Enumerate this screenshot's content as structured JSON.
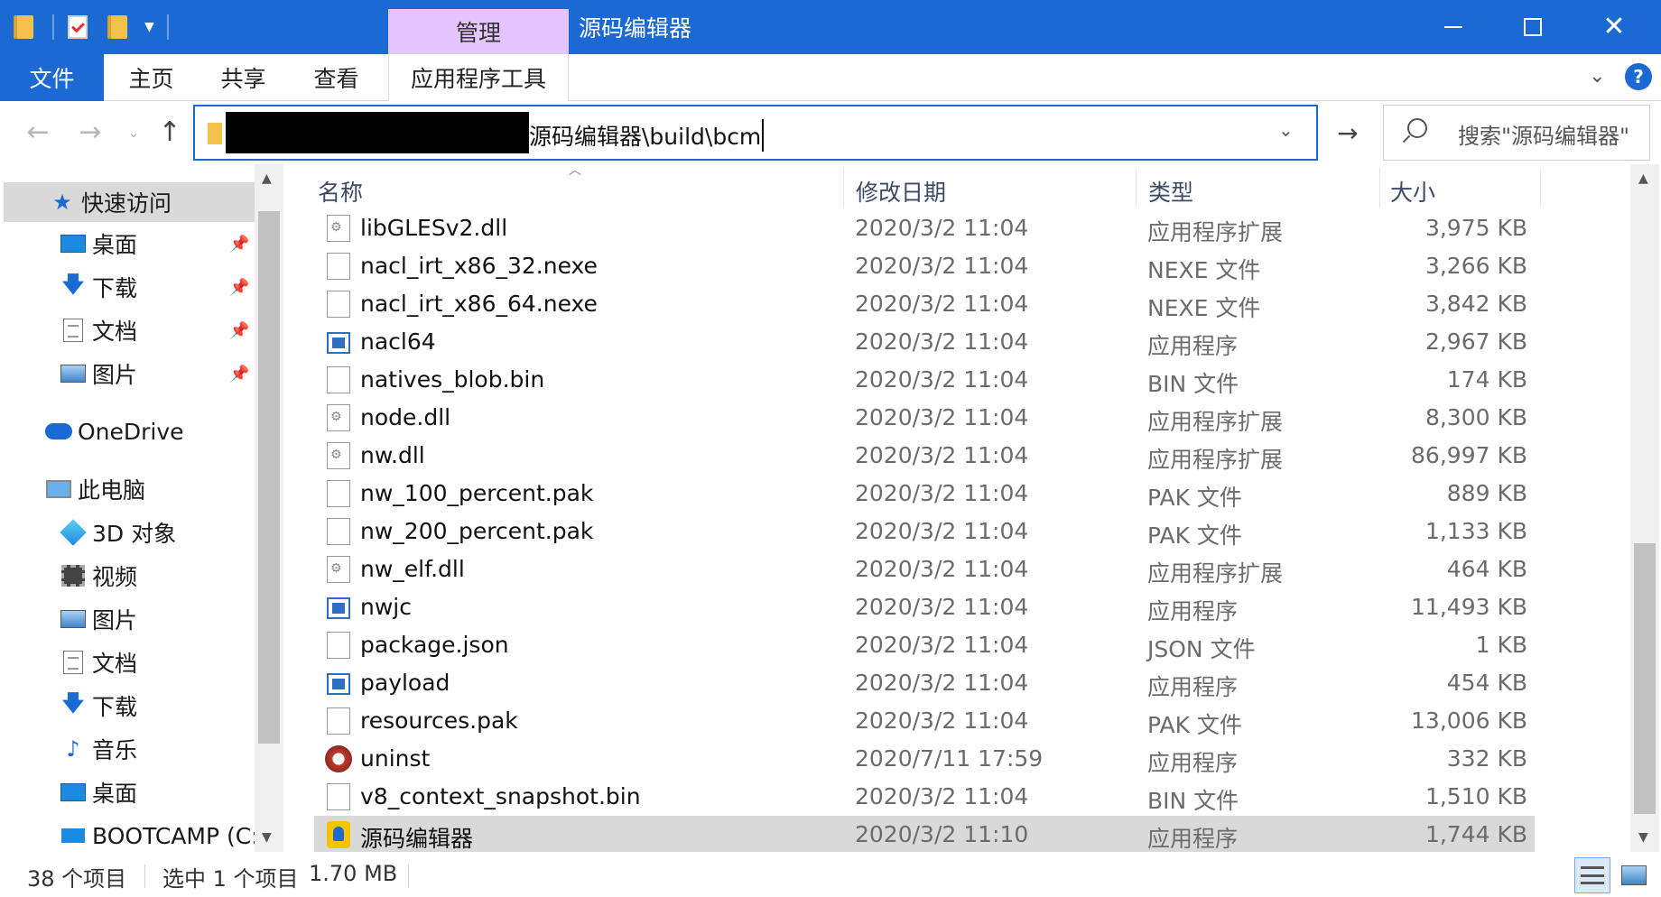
{
  "window": {
    "title": "源码编辑器",
    "context_tab": "管理"
  },
  "ribbon": {
    "tabs": [
      "文件",
      "主页",
      "共享",
      "查看",
      "应用程序工具"
    ]
  },
  "address": {
    "path_visible": "源码编辑器\\build\\bcm"
  },
  "search": {
    "placeholder": "搜索\"源码编辑器\""
  },
  "nav_pane": {
    "quick_access": "快速访问",
    "pinned": [
      "桌面",
      "下载",
      "文档",
      "图片"
    ],
    "onedrive": "OneDrive",
    "this_pc": "此电脑",
    "pc_items": [
      "3D 对象",
      "视频",
      "图片",
      "文档",
      "下载",
      "音乐",
      "桌面",
      "BOOTCAMP (C:"
    ]
  },
  "columns": {
    "name": "名称",
    "date": "修改日期",
    "type": "类型",
    "size": "大小"
  },
  "files": [
    {
      "name": "libGLESv2.dll",
      "date": "2020/3/2 11:04",
      "type": "应用程序扩展",
      "size": "3,975 KB",
      "icon": "dll"
    },
    {
      "name": "nacl_irt_x86_32.nexe",
      "date": "2020/3/2 11:04",
      "type": "NEXE 文件",
      "size": "3,266 KB",
      "icon": "blank"
    },
    {
      "name": "nacl_irt_x86_64.nexe",
      "date": "2020/3/2 11:04",
      "type": "NEXE 文件",
      "size": "3,842 KB",
      "icon": "blank"
    },
    {
      "name": "nacl64",
      "date": "2020/3/2 11:04",
      "type": "应用程序",
      "size": "2,967 KB",
      "icon": "exe"
    },
    {
      "name": "natives_blob.bin",
      "date": "2020/3/2 11:04",
      "type": "BIN 文件",
      "size": "174 KB",
      "icon": "blank"
    },
    {
      "name": "node.dll",
      "date": "2020/3/2 11:04",
      "type": "应用程序扩展",
      "size": "8,300 KB",
      "icon": "dll"
    },
    {
      "name": "nw.dll",
      "date": "2020/3/2 11:04",
      "type": "应用程序扩展",
      "size": "86,997 KB",
      "icon": "dll"
    },
    {
      "name": "nw_100_percent.pak",
      "date": "2020/3/2 11:04",
      "type": "PAK 文件",
      "size": "889 KB",
      "icon": "blank"
    },
    {
      "name": "nw_200_percent.pak",
      "date": "2020/3/2 11:04",
      "type": "PAK 文件",
      "size": "1,133 KB",
      "icon": "blank"
    },
    {
      "name": "nw_elf.dll",
      "date": "2020/3/2 11:04",
      "type": "应用程序扩展",
      "size": "464 KB",
      "icon": "dll"
    },
    {
      "name": "nwjc",
      "date": "2020/3/2 11:04",
      "type": "应用程序",
      "size": "11,493 KB",
      "icon": "exe"
    },
    {
      "name": "package.json",
      "date": "2020/3/2 11:04",
      "type": "JSON 文件",
      "size": "1 KB",
      "icon": "blank"
    },
    {
      "name": "payload",
      "date": "2020/3/2 11:04",
      "type": "应用程序",
      "size": "454 KB",
      "icon": "exe"
    },
    {
      "name": "resources.pak",
      "date": "2020/3/2 11:04",
      "type": "PAK 文件",
      "size": "13,006 KB",
      "icon": "blank"
    },
    {
      "name": "uninst",
      "date": "2020/7/11 17:59",
      "type": "应用程序",
      "size": "332 KB",
      "icon": "uninst"
    },
    {
      "name": "v8_context_snapshot.bin",
      "date": "2020/3/2 11:04",
      "type": "BIN 文件",
      "size": "1,510 KB",
      "icon": "blank"
    },
    {
      "name": "源码编辑器",
      "date": "2020/3/2 11:10",
      "type": "应用程序",
      "size": "1,744 KB",
      "icon": "app",
      "selected": true
    }
  ],
  "status": {
    "count": "38 个项目",
    "selection": "选中 1 个项目",
    "selection_size": "1.70 MB"
  },
  "icons": {
    "back": "arrow-left-icon",
    "forward": "arrow-right-icon",
    "up": "arrow-up-icon",
    "go": "arrow-go-icon",
    "search": "search-icon",
    "help": "help-icon"
  }
}
